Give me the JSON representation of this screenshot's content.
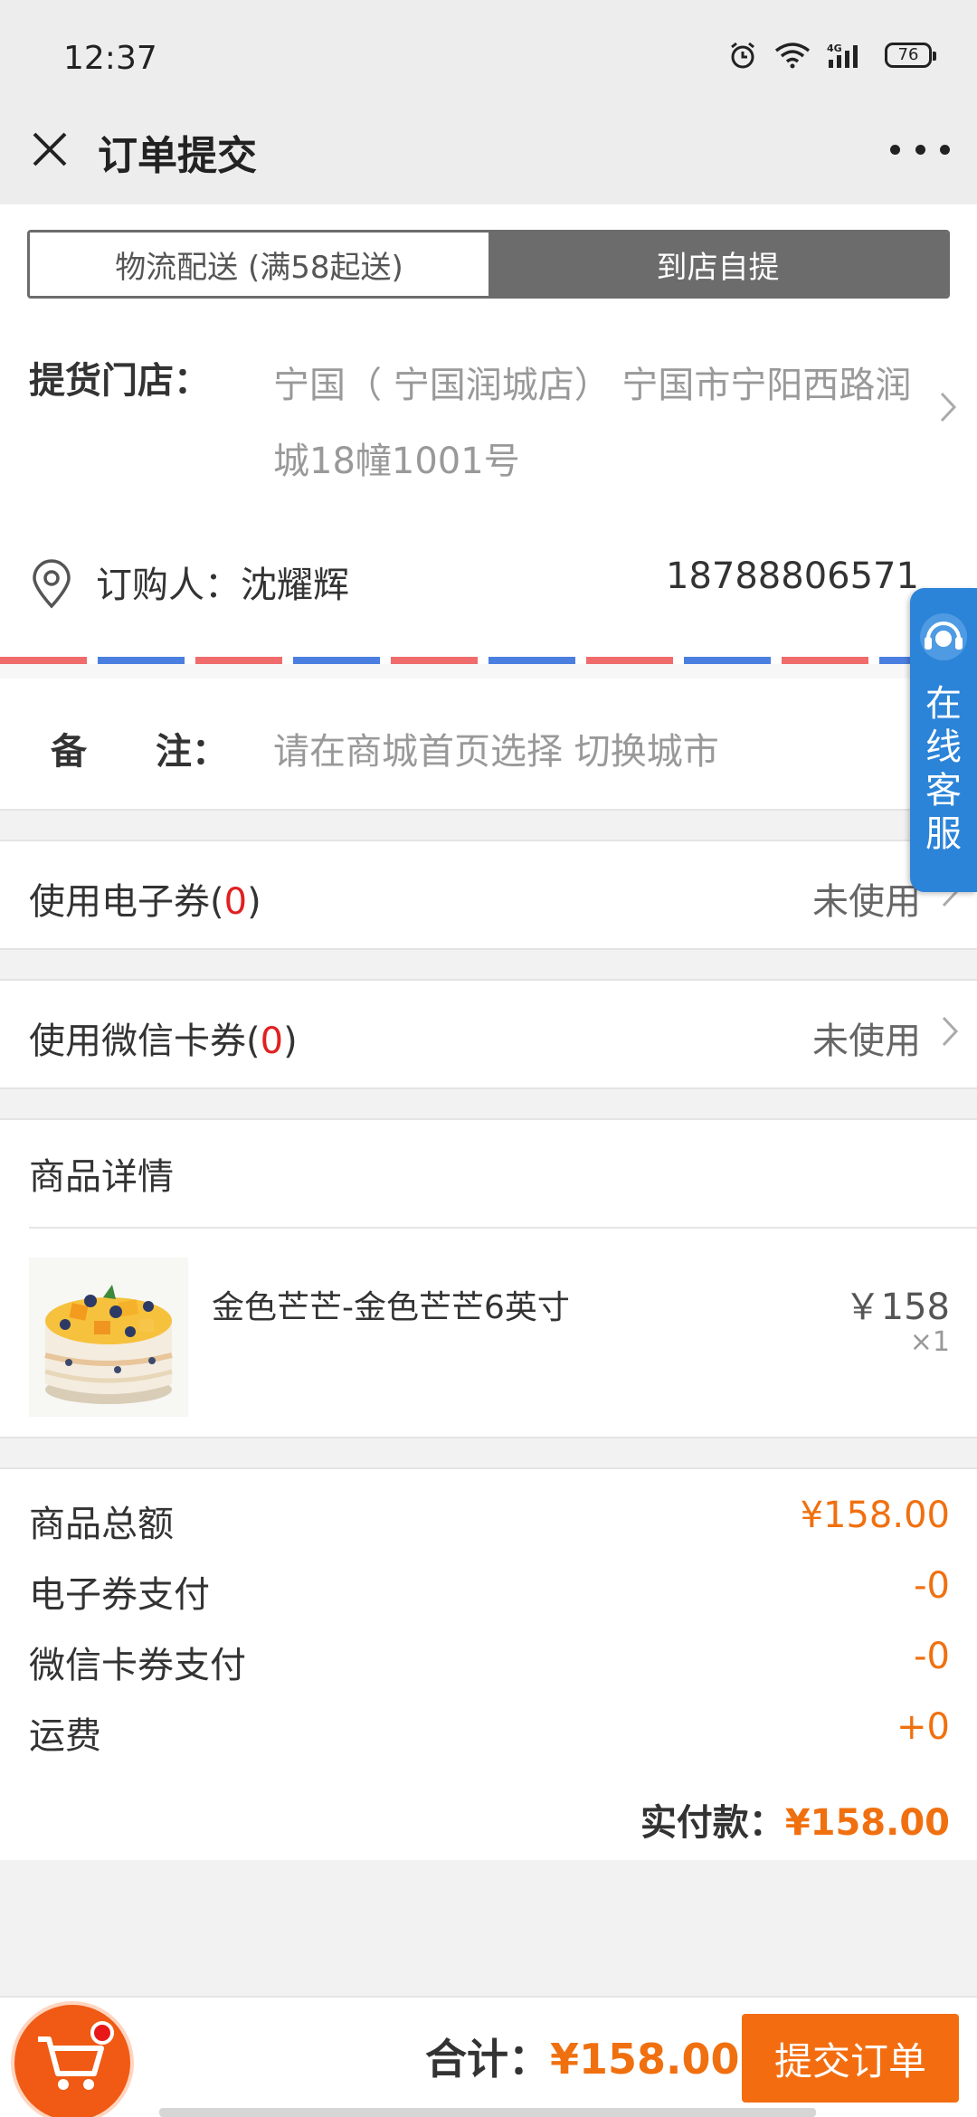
{
  "status_bar": {
    "time": "12:37",
    "battery": "76",
    "network": "4G"
  },
  "nav": {
    "title": "订单提交",
    "close_icon": "close-icon",
    "more_icon": "more-icon"
  },
  "delivery_tabs": [
    {
      "label": "物流配送 (满58起送)",
      "active": false
    },
    {
      "label": "到店自提",
      "active": true
    }
  ],
  "pickup": {
    "label": "提货门店：",
    "address": "宁国（ 宁国润城店） 宁国市宁阳西路润城18幢1001号"
  },
  "buyer": {
    "label": "订购人：沈耀辉",
    "phone": "18788806571"
  },
  "remark": {
    "label_a": "备",
    "label_b": "注：",
    "placeholder": "请在商城首页选择 切换城市"
  },
  "coupons": [
    {
      "label_prefix": "使用电子券(",
      "count": "0",
      "label_suffix": ")",
      "value": "未使用"
    },
    {
      "label_prefix": "使用微信卡券(",
      "count": "0",
      "label_suffix": ")",
      "value": "未使用"
    }
  ],
  "products": {
    "heading": "商品详情",
    "items": [
      {
        "name": "金色芒芒-金色芒芒6英寸",
        "price": "￥158",
        "qty": "×1"
      }
    ]
  },
  "summary": {
    "lines": [
      {
        "label": "商品总额",
        "value": "¥158.00"
      },
      {
        "label": "电子券支付",
        "value": "-0"
      },
      {
        "label": "微信卡券支付",
        "value": "-0"
      },
      {
        "label": "运费",
        "value": "+0"
      }
    ],
    "total_label": "实付款：",
    "total_value": "¥158.00"
  },
  "bottom_bar": {
    "sum_label": "合计：",
    "sum_value": "¥158.00",
    "submit_label": "提交订单"
  },
  "service_float": {
    "label": "在线客服"
  },
  "colors": {
    "accent": "#f07010",
    "tab_active": "#6c6c6c",
    "service_blue": "#2b84d8",
    "red": "#e02020"
  }
}
